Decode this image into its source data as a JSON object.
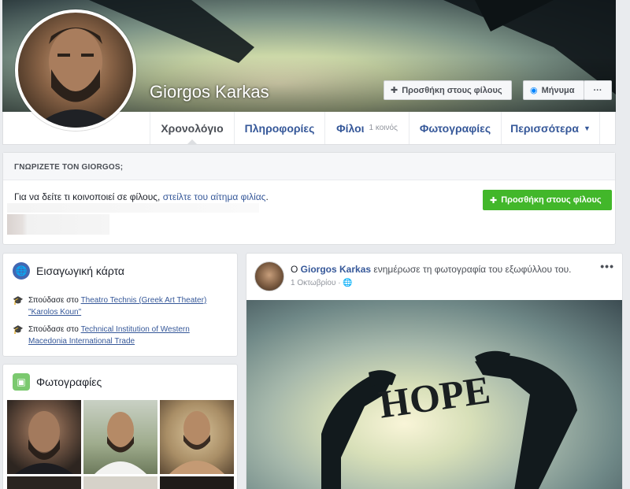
{
  "profile": {
    "name": "Giorgos Karkas",
    "add_friend_label": "Προσθήκη στους φίλους",
    "message_label": "Μήνυμα",
    "more_label": "···"
  },
  "tabs": [
    {
      "label": "Χρονολόγιο",
      "sub": "",
      "active": true
    },
    {
      "label": "Πληροφορίες",
      "sub": ""
    },
    {
      "label": "Φίλοι",
      "sub": "1 κοινός"
    },
    {
      "label": "Φωτογραφίες",
      "sub": ""
    },
    {
      "label": "Περισσότερα",
      "sub": "▼"
    }
  ],
  "know": {
    "heading": "ΓΝΩΡΙΖΕΤΕ ΤΟΝ GIORGOS;",
    "text_prefix": "Για να δείτε τι κοινοποιεί σε φίλους, ",
    "link": "στείλτε του αίτημα φιλίας",
    "text_suffix": ".",
    "button_label": "Προσθήκη στους φίλους"
  },
  "intro": {
    "title": "Εισαγωγική κάρτα",
    "items": [
      {
        "prefix": "Σπούδασε στο ",
        "link": "Theatro Technis (Greek Art Theater) \"Karolos Koun\""
      },
      {
        "prefix": "Σπούδασε στο ",
        "link": "Technical Institution of Western Macedonia International Trade"
      }
    ]
  },
  "photos": {
    "title": "Φωτογραφίες"
  },
  "post": {
    "prefix": "Ο ",
    "author": "Giorgos Karkas",
    "action": " ενημέρωσε τη φωτογραφία του εξωφύλλου του.",
    "date": "1 Οκτωβρίου",
    "more": "•••",
    "image_text": "HOPE"
  },
  "colors": {
    "link": "#365899",
    "green": "#42b72a",
    "page_bg": "#e9ebee"
  }
}
